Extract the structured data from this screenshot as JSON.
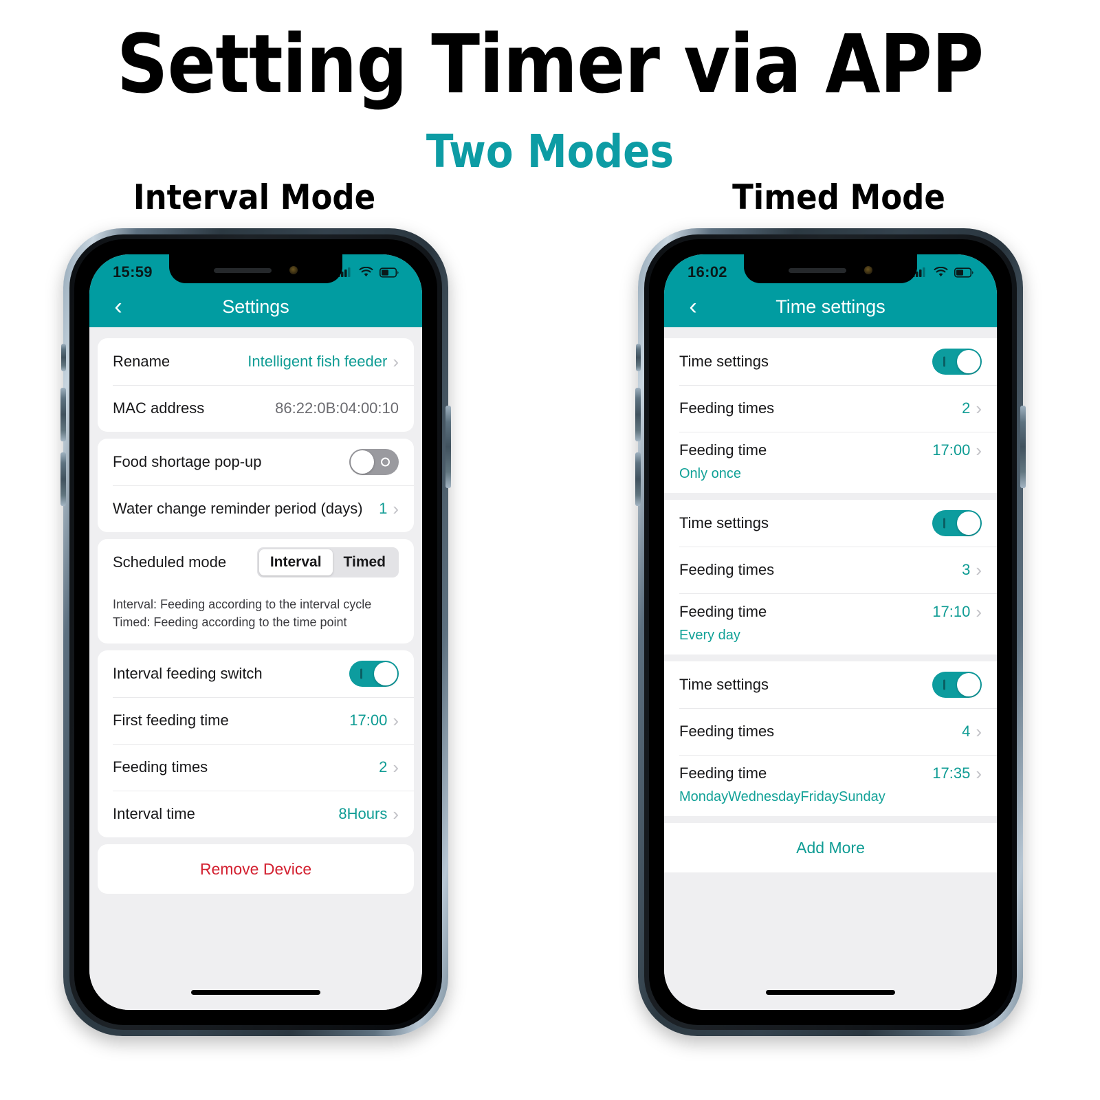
{
  "header": {
    "title": "Setting Timer via APP",
    "subtitle": "Two Modes",
    "left_mode_label": "Interval Mode",
    "right_mode_label": "Timed Mode"
  },
  "colors": {
    "teal": "#019CA1",
    "accent_text": "#0F9C94",
    "danger": "#D32030",
    "screen_bg": "#efeff1"
  },
  "interval_phone": {
    "status": {
      "time": "15:59",
      "signal_icon": "cellular-signal-icon",
      "wifi_icon": "wifi-icon",
      "battery_icon": "battery-icon"
    },
    "nav": {
      "back_icon": "chevron-left-icon",
      "title": "Settings"
    },
    "rows": {
      "rename_label": "Rename",
      "rename_value": "Intelligent fish feeder",
      "mac_label": "MAC address",
      "mac_value": "86:22:0B:04:00:10",
      "food_shortage_label": "Food shortage pop-up",
      "food_shortage_state": "off",
      "water_change_label": "Water change reminder period (days)",
      "water_change_value": "1",
      "scheduled_mode_label": "Scheduled mode",
      "segment_interval": "Interval",
      "segment_timed": "Timed",
      "segment_selected": "Interval",
      "note_line1": "Interval: Feeding according to the interval cycle",
      "note_line2": "Timed: Feeding according to the time point",
      "interval_switch_label": "Interval feeding switch",
      "interval_switch_state": "on",
      "first_feeding_label": "First feeding time",
      "first_feeding_value": "17:00",
      "feeding_times_label": "Feeding times",
      "feeding_times_value": "2",
      "interval_time_label": "Interval time",
      "interval_time_value": "8Hours",
      "remove_device_label": "Remove Device"
    }
  },
  "timed_phone": {
    "status": {
      "time": "16:02",
      "signal_icon": "cellular-signal-icon",
      "wifi_icon": "wifi-icon",
      "battery_icon": "battery-icon"
    },
    "nav": {
      "back_icon": "chevron-left-icon",
      "title": "Time settings"
    },
    "labels": {
      "time_settings": "Time settings",
      "feeding_times": "Feeding times",
      "feeding_time": "Feeding time",
      "add_more": "Add More"
    },
    "schedules": [
      {
        "toggle_state": "on",
        "feeding_times_value": "2",
        "feeding_time_value": "17:00",
        "repeat": "Only once"
      },
      {
        "toggle_state": "on",
        "feeding_times_value": "3",
        "feeding_time_value": "17:10",
        "repeat": "Every day"
      },
      {
        "toggle_state": "on",
        "feeding_times_value": "4",
        "feeding_time_value": "17:35",
        "repeat": "MondayWednesdayFridaySunday"
      }
    ]
  }
}
